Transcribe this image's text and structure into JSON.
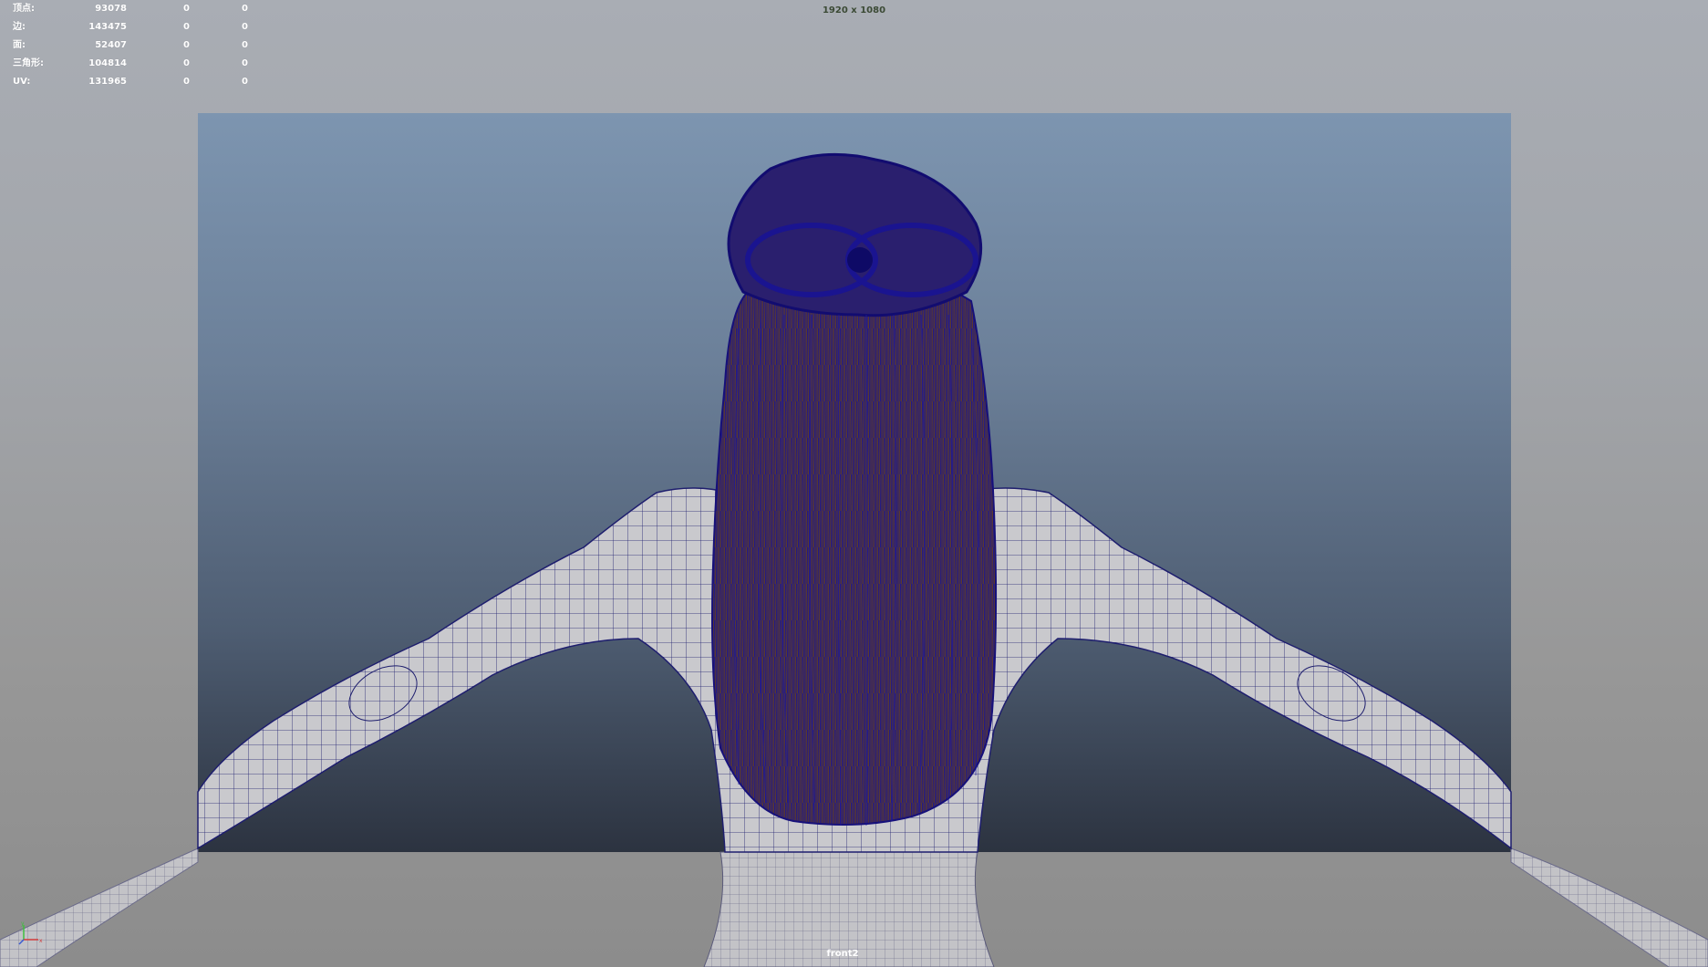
{
  "hud": {
    "rows": [
      {
        "label": "顶点:",
        "value": "93078",
        "sel1": "0",
        "sel2": "0"
      },
      {
        "label": "边:",
        "value": "143475",
        "sel1": "0",
        "sel2": "0"
      },
      {
        "label": "面:",
        "value": "52407",
        "sel1": "0",
        "sel2": "0"
      },
      {
        "label": "三角形:",
        "value": "104814",
        "sel1": "0",
        "sel2": "0"
      },
      {
        "label": "UV:",
        "value": "131965",
        "sel1": "0",
        "sel2": "0"
      }
    ]
  },
  "resolution_gate_label": "1920 x 1080",
  "camera_name": "front2",
  "colors": {
    "wire": "#1e1e6e",
    "hair_wire": "#1a1580",
    "hair_base": "#5a3a2a",
    "skin": "#c8c8cc",
    "gate_top": "#7d95b0",
    "gate_bottom": "#2c3340"
  },
  "icons": {
    "axis": "xyz-axis-gizmo-icon"
  }
}
